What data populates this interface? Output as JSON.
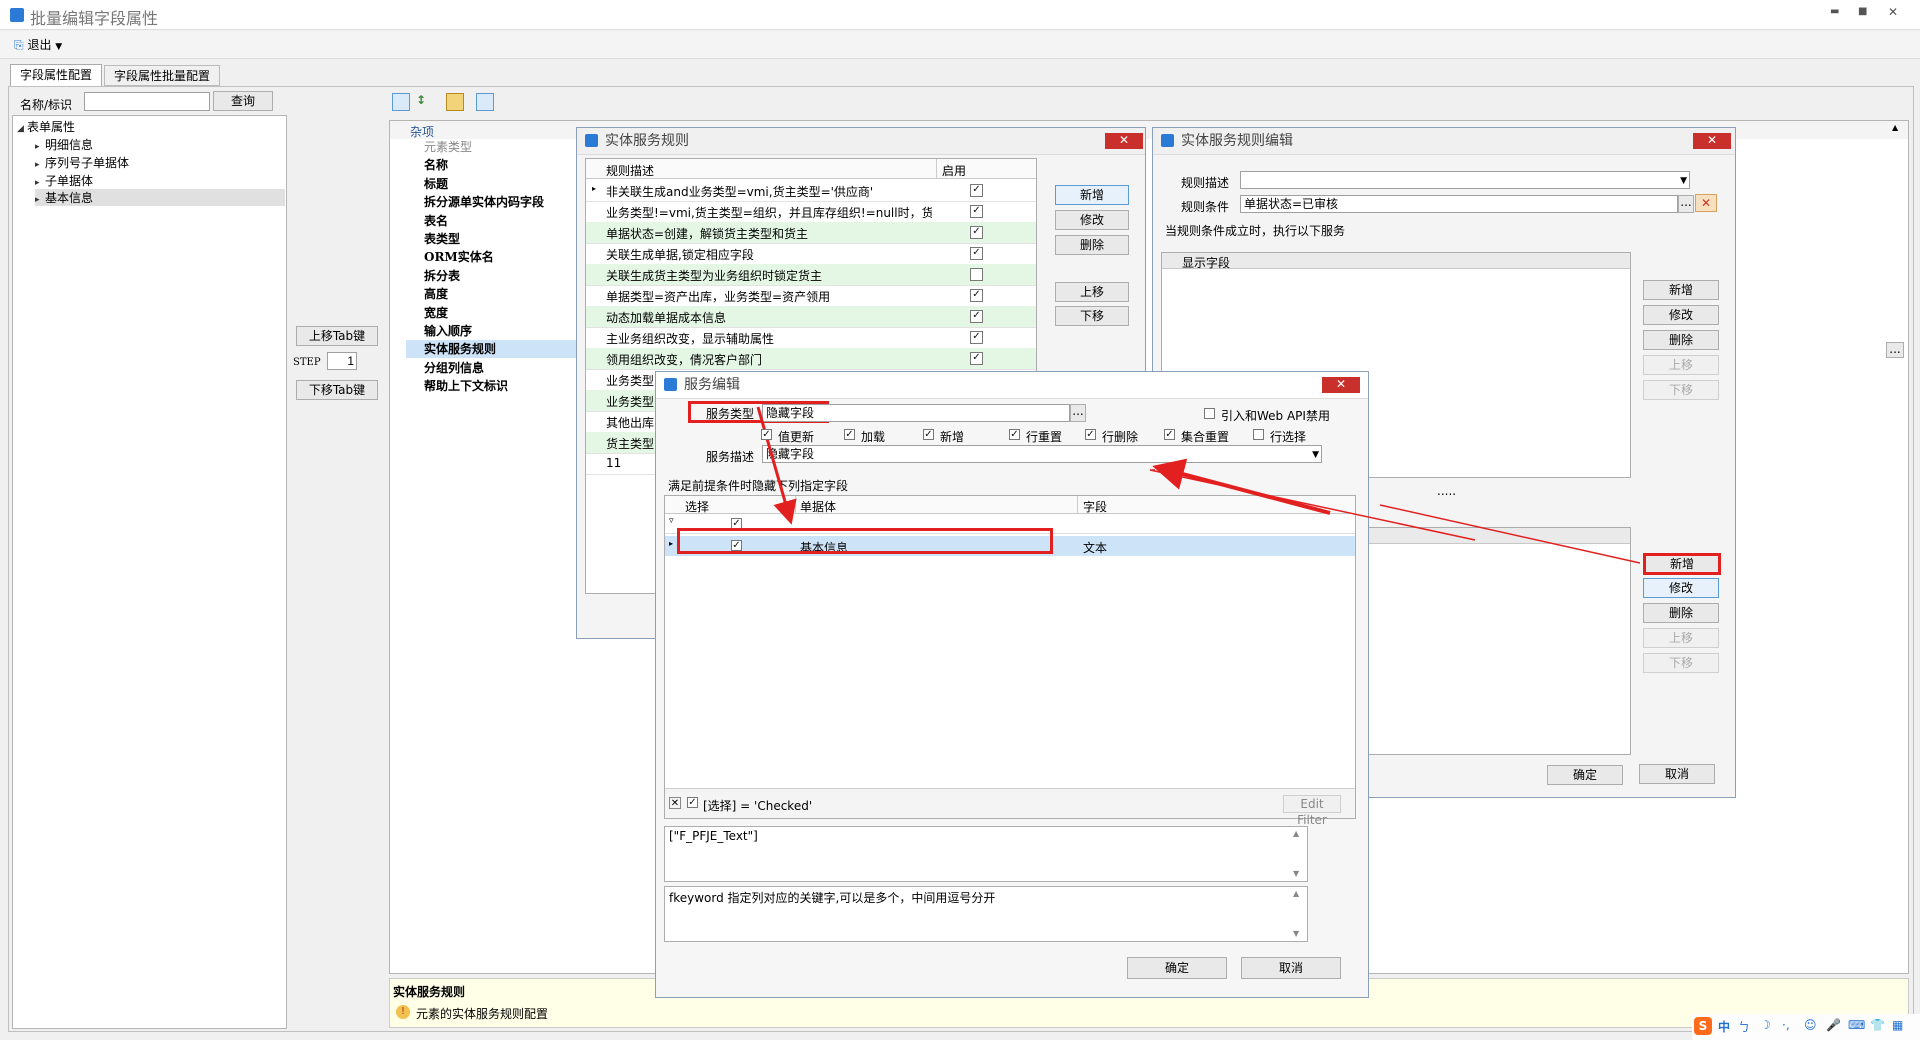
{
  "window": {
    "title": "批量编辑字段属性",
    "minimize": "▬",
    "maximize": "■",
    "close": "✕"
  },
  "toolbar": {
    "exit_label": "退出"
  },
  "tabs": [
    {
      "label": "字段属性配置"
    },
    {
      "label": "字段属性批量配置"
    }
  ],
  "search": {
    "label": "名称/标识",
    "value": "",
    "button": "查询"
  },
  "tree": {
    "root": "表单属性",
    "children": [
      "明细信息",
      "序列号子单据体",
      "子单据体",
      "基本信息"
    ]
  },
  "tabkey": {
    "up": "上移Tab键",
    "step_label": "STEP",
    "step_value": "1",
    "down": "下移Tab键"
  },
  "propgrid": {
    "category": "杂项",
    "rows": [
      "元素类型",
      "名称",
      "标题",
      "拆分源单实体内码字段",
      "表名",
      "表类型",
      "ORM实体名",
      "拆分表",
      "高度",
      "宽度",
      "输入顺序",
      "实体服务规则",
      "分组列信息",
      "帮助上下文标识"
    ]
  },
  "description": {
    "title": "实体服务规则",
    "text": "元素的实体服务规则配置"
  },
  "rules_dialog": {
    "title": "实体服务规则",
    "col_desc": "规则描述",
    "col_enabled": "启用",
    "rows": [
      {
        "text": "非关联生成and业务类型=vmi,货主类型='供应商'",
        "checked": true,
        "green": false
      },
      {
        "text": "业务类型!=vmi,货主类型=组织，并且库存组织!=null时，货...",
        "checked": true,
        "green": false
      },
      {
        "text": "单据状态=创建，解锁货主类型和货主",
        "checked": true,
        "green": true
      },
      {
        "text": "关联生成单据,锁定相应字段",
        "checked": true,
        "green": false
      },
      {
        "text": "关联生成货主类型为业务组织时锁定货主",
        "checked": false,
        "green": true
      },
      {
        "text": "单据类型=资产出库，业务类型=资产领用",
        "checked": true,
        "green": false
      },
      {
        "text": "动态加载单据成本信息",
        "checked": true,
        "green": true
      },
      {
        "text": "主业务组织改变，显示辅助属性",
        "checked": true,
        "green": false
      },
      {
        "text": "领用组织改变，倩况客户部门",
        "checked": true,
        "green": true
      },
      {
        "text": "业务类型",
        "checked": false,
        "green": false
      },
      {
        "text": "业务类型",
        "checked": false,
        "green": true
      },
      {
        "text": "其他出库",
        "checked": false,
        "green": false
      },
      {
        "text": "货主类型",
        "checked": false,
        "green": true
      },
      {
        "text": "11",
        "checked": false,
        "green": false
      }
    ],
    "buttons": {
      "add": "新增",
      "edit": "修改",
      "delete": "删除",
      "up": "上移",
      "down": "下移"
    }
  },
  "rule_edit": {
    "title": "实体服务规则编辑",
    "desc_label": "规则描述",
    "desc_value": "",
    "cond_label": "规则条件",
    "cond_value": "单据状态=已审核",
    "services_label": "当规则条件成立时，执行以下服务",
    "list1_header": "显示字段",
    "buttons1": {
      "add": "新增",
      "edit": "修改",
      "delete": "删除",
      "up": "上移",
      "down": "下移"
    },
    "dots": ".....",
    "buttons2": {
      "add": "新增",
      "edit": "修改",
      "delete": "删除",
      "up": "上移",
      "down": "下移"
    },
    "ok": "确定",
    "cancel": "取消"
  },
  "service_edit": {
    "title": "服务编辑",
    "type_label": "服务类型",
    "type_value": "隐藏字段",
    "webapi_label": "引入和Web API禁用",
    "checks": [
      {
        "label": "值更新",
        "checked": true
      },
      {
        "label": "加载",
        "checked": true
      },
      {
        "label": "新增",
        "checked": true
      },
      {
        "label": "行重置",
        "checked": true
      },
      {
        "label": "行删除",
        "checked": true
      },
      {
        "label": "集合重置",
        "checked": true
      },
      {
        "label": "行选择",
        "checked": false
      }
    ],
    "desc_label": "服务描述",
    "desc_value": "隐藏字段",
    "section_label": "满足前提条件时隐藏下列指定字段",
    "col_select": "选择",
    "col_entity": "单据体",
    "col_field": "字段",
    "row": {
      "entity": "基本信息",
      "field": "文本"
    },
    "filter_text": "[选择] = 'Checked'",
    "edit_filter": "Edit Filter",
    "json_text": "[\"F_PFJE_Text\"]",
    "hint_text": "fkeyword  指定列对应的关键字,可以是多个，中间用逗号分开",
    "ok": "确定",
    "cancel": "取消"
  },
  "taskbar": {
    "ime": "中",
    "symbols": [
      "ㄅ",
      "☽",
      "·,",
      "☺",
      "🎤",
      "⌨",
      "👕",
      "▦"
    ]
  },
  "colors": {
    "highlight": "#e32020",
    "selected": "#cde3f7",
    "green_row": "#e4f7e4"
  }
}
